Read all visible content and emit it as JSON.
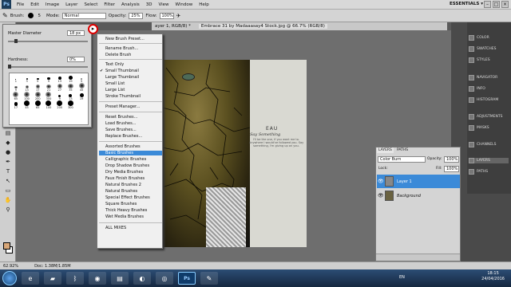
{
  "app": {
    "logo": "Ps"
  },
  "menubar": [
    "File",
    "Edit",
    "Image",
    "Layer",
    "Select",
    "Filter",
    "Analysis",
    "3D",
    "View",
    "Window",
    "Help"
  ],
  "workspace": {
    "essentials": "ESSENTIALS ▾"
  },
  "options": {
    "brush_label": "Brush:",
    "brush_size": "5",
    "mode_label": "Mode:",
    "mode_value": "Normal",
    "opacity_label": "Opacity:",
    "opacity_value": "25%",
    "flow_label": "Flow:",
    "flow_value": "100%"
  },
  "doc": {
    "tab_prev": "ayer 1, RGB/8) *",
    "tab_active": "Embrace 31 by Madaaasay4 Stock.jpg @ 66.7% (RGB/8)",
    "zoom": "62.92%",
    "doc_size": "Doc: 1.38M/1.85M"
  },
  "brush_picker": {
    "diameter_label": "Master Diameter",
    "diameter_value": "18 px",
    "hardness_label": "Hardness:",
    "hardness_value": "0%",
    "sizes": [
      "1",
      "3",
      "5",
      "9",
      "13",
      "19",
      "5",
      "9",
      "13",
      "17",
      "21",
      "27",
      "35",
      "45",
      "65",
      "100",
      "200",
      "300",
      "9",
      "13",
      "19",
      "17",
      "45",
      "65",
      "100",
      "200",
      "300"
    ]
  },
  "brush_menu": {
    "new_preset": "New Brush Preset...",
    "rename": "Rename Brush...",
    "delete": "Delete Brush",
    "text_only": "Text Only",
    "small_thumb": "Small Thumbnail",
    "large_thumb": "Large Thumbnail",
    "small_list": "Small List",
    "large_list": "Large List",
    "stroke_thumb": "Stroke Thumbnail",
    "preset_manager": "Preset Manager...",
    "reset": "Reset Brushes...",
    "load": "Load Brushes...",
    "save": "Save Brushes...",
    "replace": "Replace Brushes...",
    "sets": [
      "Assorted Brushes",
      "Basic Brushes",
      "Calligraphic Brushes",
      "Drop Shadow Brushes",
      "Dry Media Brushes",
      "Faux Finish Brushes",
      "Natural Brushes 2",
      "Natural Brushes",
      "Special Effect Brushes",
      "Square Brushes",
      "Thick Heavy Brushes",
      "Wet Media Brushes"
    ],
    "all_mixes": "ALL MIXES",
    "checkmark": "✔"
  },
  "artwork": {
    "title": "EAU",
    "subtitle": "Say Something",
    "small_text": "I'll be the one, if you want me to. Anywhere I would've followed you. Say something, I'm giving up on you."
  },
  "dock": [
    "COLOR",
    "SWATCHES",
    "STYLES",
    "NAVIGATOR",
    "INFO",
    "HISTOGRAM",
    "ADJUSTMENTS",
    "MASKS",
    "CHANNELS",
    "LAYERS",
    "PATHS"
  ],
  "layers_panel": {
    "tabs": [
      "LAYERS",
      "PATHS"
    ],
    "blend": "Color Burn",
    "opacity_label": "Opacity:",
    "opacity": "100%",
    "lock_label": "Lock:",
    "fill_label": "Fill:",
    "fill": "100%",
    "layers": [
      "Layer 1",
      "Background"
    ]
  },
  "taskbar": {
    "time": "18:15",
    "date": "24/04/2016",
    "lang": "EN"
  }
}
